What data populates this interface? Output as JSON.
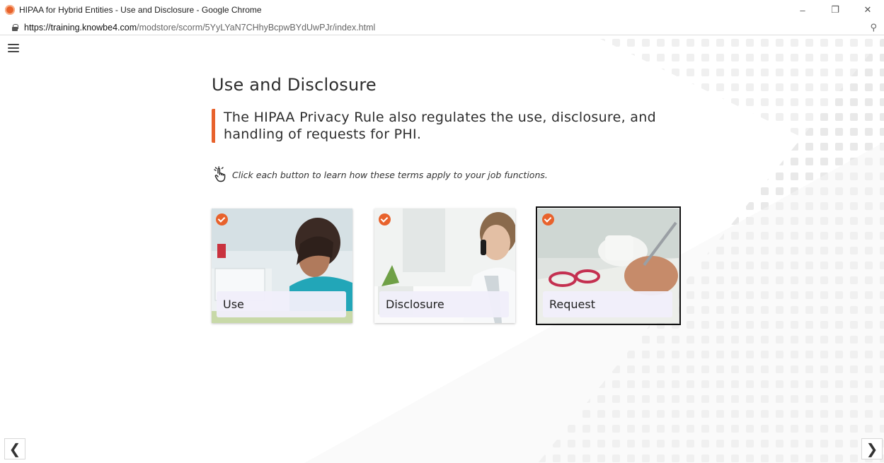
{
  "browser": {
    "window_title": "HIPAA for Hybrid Entities - Use and Disclosure - Google Chrome",
    "url_host": "https://training.knowbe4.com",
    "url_path": "/modstore/scorm/5YyLYaN7CHhyBcpwBYdUwPJr/index.html",
    "controls": {
      "minimize": "–",
      "restore": "❐",
      "close": "✕"
    },
    "zoom_icon": "⚲"
  },
  "content": {
    "title": "Use and Disclosure",
    "quote": "The HIPAA Privacy Rule also regulates the use, disclosure, and handling of requests for PHI.",
    "instruction": "Click each button to learn how these terms apply to your job functions."
  },
  "cards": [
    {
      "label": "Use",
      "completed": true,
      "selected": false
    },
    {
      "label": "Disclosure",
      "completed": true,
      "selected": false
    },
    {
      "label": "Request",
      "completed": true,
      "selected": true
    }
  ],
  "navigation": {
    "prev": "❮",
    "next": "❯"
  },
  "colors": {
    "accent": "#e8622c",
    "card_label_bg": "#f0eefa",
    "text": "#2d2d2d"
  }
}
